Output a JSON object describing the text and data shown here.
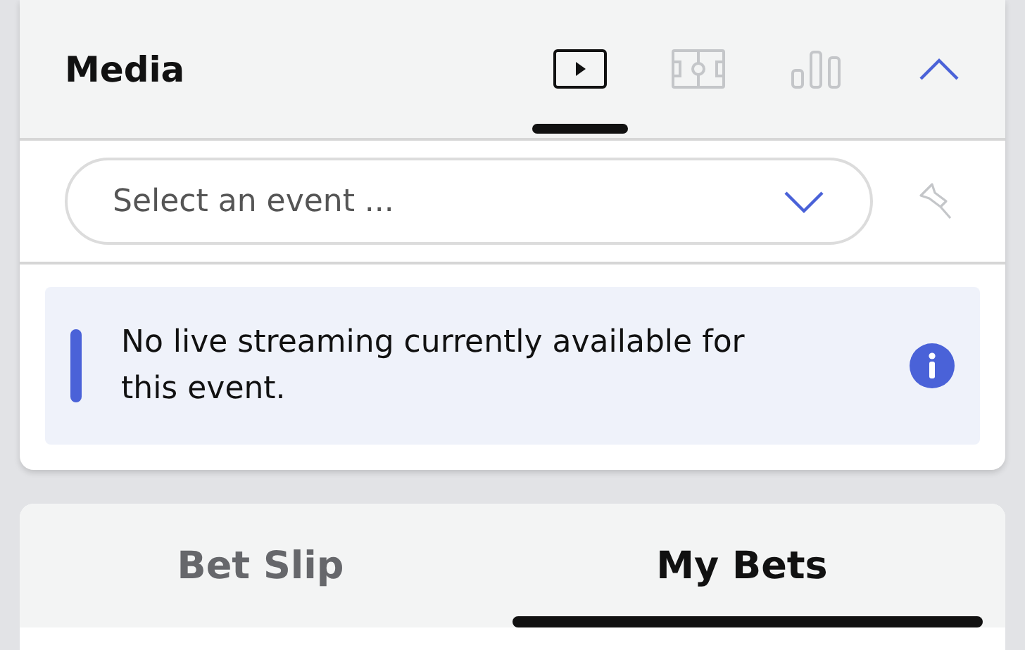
{
  "media": {
    "title": "Media",
    "expanded": true,
    "tabs": [
      {
        "kind": "video",
        "selected": true
      },
      {
        "kind": "pitch",
        "selected": false
      },
      {
        "kind": "stats",
        "selected": false
      }
    ],
    "event_select": {
      "placeholder": "Select an event ...",
      "pinned": false
    },
    "notice": "No live streaming currently available for this event."
  },
  "bet_tabs": [
    {
      "label": "Bet Slip",
      "selected": false
    },
    {
      "label": "My Bets",
      "selected": true
    }
  ]
}
